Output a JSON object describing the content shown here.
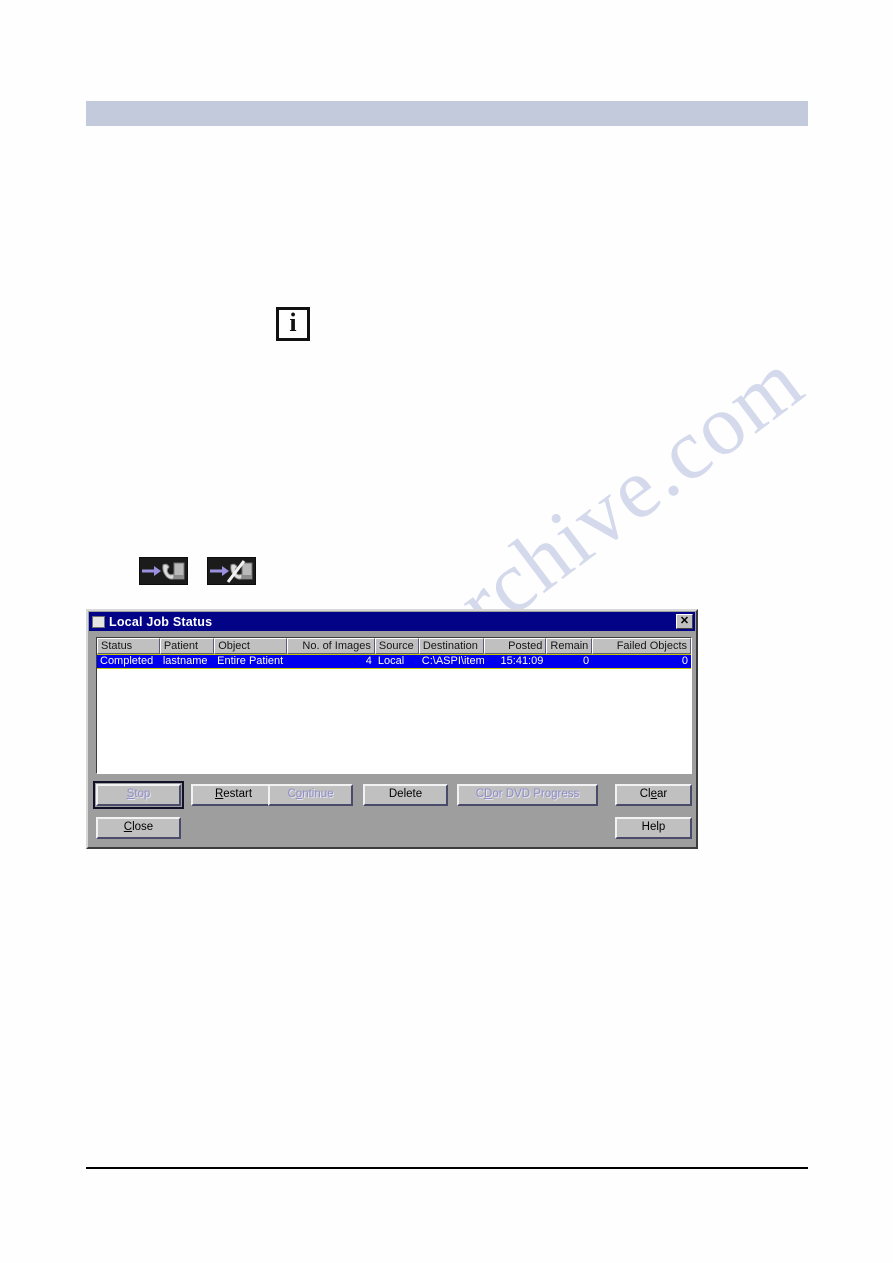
{
  "page": {
    "header_bar_color": "#c3cadb",
    "watermark_text": "manualsarchive.com",
    "info_icon_glyph": "i"
  },
  "toolbar_icons": [
    {
      "name": "connect-icon",
      "title": "connect"
    },
    {
      "name": "disconnect-icon",
      "title": "disconnect"
    }
  ],
  "dialog": {
    "title": "Local Job Status",
    "close_label": "✕",
    "colors": {
      "titlebar": "#030388",
      "selection": "#0000ee",
      "face": "#c0c0c0",
      "dialog_face": "#9e9e9e",
      "disabled_text": "#8e8ec4"
    },
    "table": {
      "columns": [
        {
          "label": "Status",
          "align": "left"
        },
        {
          "label": "Patient",
          "align": "left"
        },
        {
          "label": "Object",
          "align": "left"
        },
        {
          "label": "No. of Images",
          "align": "right"
        },
        {
          "label": "Source",
          "align": "left"
        },
        {
          "label": "Destination",
          "align": "left"
        },
        {
          "label": "Posted",
          "align": "right"
        },
        {
          "label": "Remain",
          "align": "right"
        },
        {
          "label": "Failed Objects",
          "align": "right"
        }
      ],
      "rows": [
        {
          "status": "Completed",
          "patient": "lastname",
          "object": "Entire Patient",
          "images": "4",
          "source": "Local",
          "destination": "C:\\ASPI\\item",
          "posted": "15:41:09",
          "remain": "0",
          "failed_objects": "0",
          "selected": true
        }
      ]
    },
    "buttons": {
      "stop": {
        "label": "Stop",
        "accel": "S",
        "enabled": false,
        "focused": true
      },
      "restart": {
        "label": "Restart",
        "accel": "R",
        "enabled": true,
        "focused": false
      },
      "continue": {
        "label": "Continue",
        "accel": "o",
        "enabled": false,
        "focused": false
      },
      "delete": {
        "label": "Delete",
        "accel": "",
        "enabled": true,
        "focused": false
      },
      "cd_progress": {
        "label": "CD or DVD Progress",
        "accel": "D",
        "enabled": false,
        "focused": false
      },
      "clear": {
        "label": "Clear",
        "accel": "e",
        "enabled": true,
        "focused": false
      },
      "close": {
        "label": "Close",
        "accel": "C",
        "enabled": true,
        "focused": false
      },
      "help": {
        "label": "Help",
        "accel": "",
        "enabled": true,
        "focused": false
      }
    }
  }
}
